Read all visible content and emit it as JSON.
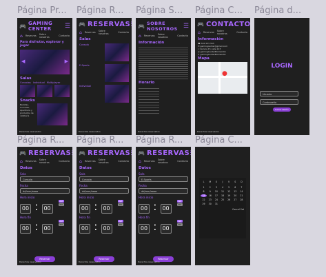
{
  "frames": {
    "f1_label": "Página Pr...",
    "f2_label": "Página R...",
    "f3_label": "Página S...",
    "f4_label": "Página C...",
    "f5_label": "Página d...",
    "r2_f1_label": "Página R...",
    "r2_f2_label": "Página R...",
    "r2_f3_label": "Página R...",
    "r2_f4_label": "Página C..."
  },
  "home": {
    "title": "GAMING CENTER",
    "nav": [
      "Reservas",
      "Sobre nosotros",
      "Contacto"
    ],
    "hero": "Para disfrutar, explorar y jugar",
    "salas_title": "Salas",
    "salas": [
      "Consolas",
      "Individual",
      "Multiplayer"
    ],
    "snacks_title": "Snacks",
    "snacks_text": "Bebidas, Comidas, Aperitivos y productos de cafetería",
    "footer": "Derechos reservados"
  },
  "reservas": {
    "title": "RESERVAS",
    "nav": [
      "Reservas",
      "Sobre nosotros",
      "Contacto"
    ],
    "salas_title": "Salas",
    "items": [
      "Consola",
      "E-Sports",
      "Individual"
    ],
    "footer": "Derechos reservados"
  },
  "sobre": {
    "title": "SOBRE NOSOTROS",
    "nav": [
      "Reservas",
      "Sobre nosotros",
      "Contacto"
    ],
    "info_title": "Información",
    "horario_title": "Horario",
    "footer": "Derechos reservados"
  },
  "contacto": {
    "title": "CONTACTO",
    "nav": [
      "Reservas",
      "Sobre nosotros",
      "Contacto"
    ],
    "info_title": "Información",
    "lines": [
      "555 555 555",
      "gamingcenter@gmail.com",
      "Carrera 15 calle 123",
      "gamingCenterBiomeCAS",
      "gamingCenterBiomeCAS"
    ],
    "mapa_title": "Mapa",
    "footer": "Derechos reservados"
  },
  "login": {
    "title": "LOGIN",
    "user_placeholder": "Usuario",
    "pass_placeholder": "Contraseña",
    "button": "Iniciar sesión"
  },
  "form": {
    "title": "RESERVAS",
    "nav": [
      "Reservas",
      "Sobre nosotros",
      "Contacto"
    ],
    "datos": "Datos",
    "sala_label": "Sala",
    "fecha_label": "Fecha",
    "fecha_placeholder": "dd/mm/aaaa",
    "hora_inicio": "Hora inicio",
    "hora_fin": "Hora fin",
    "time": "00",
    "am": "AM",
    "pm": "PM",
    "button": "Reservar",
    "footer": "Derechos reservados",
    "salas": [
      "Consola",
      "Consola",
      "E-Sports"
    ]
  },
  "calendar": {
    "days": [
      "L",
      "M",
      "X",
      "J",
      "V",
      "S",
      "D"
    ],
    "numbers": [
      "1",
      "2",
      "3",
      "4",
      "5",
      "6",
      "7",
      "8",
      "9",
      "10",
      "11",
      "12",
      "13",
      "14",
      "15",
      "16",
      "17",
      "18",
      "19",
      "20",
      "21",
      "22",
      "23",
      "24",
      "25",
      "26",
      "27",
      "28",
      "29",
      "30",
      "31"
    ],
    "selected": "15",
    "actions": "Cancel  Set"
  }
}
